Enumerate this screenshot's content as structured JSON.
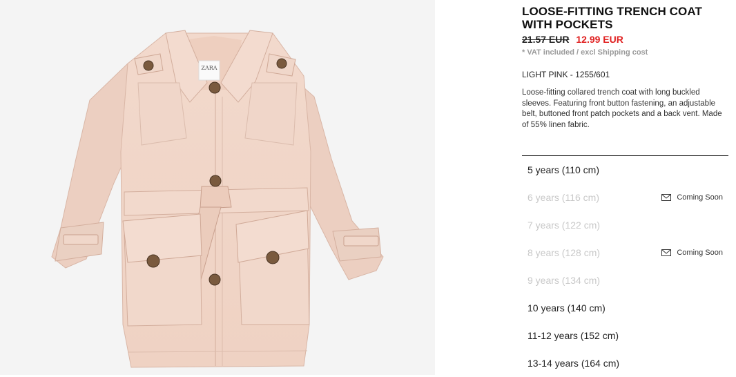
{
  "product": {
    "title": "LOOSE-FITTING TRENCH COAT WITH POCKETS",
    "old_price": "21.57 EUR",
    "new_price": "12.99 EUR",
    "vat_note": "* VAT included / excl Shipping cost",
    "color_ref": "LIGHT PINK - 1255/601",
    "description": "Loose-fitting collared trench coat with long buckled sleeves. Featuring front button fastening, an adjustable belt, buttoned front patch pockets and a back vent. Made of 55% linen fabric.",
    "label_text": "ZARA",
    "sale_color": "#e02020"
  },
  "sizes": [
    {
      "label": "5 years (110 cm)",
      "available": true,
      "note": ""
    },
    {
      "label": "6 years (116 cm)",
      "available": false,
      "note": "Coming Soon"
    },
    {
      "label": "7 years (122 cm)",
      "available": false,
      "note": ""
    },
    {
      "label": "8 years (128 cm)",
      "available": false,
      "note": "Coming Soon"
    },
    {
      "label": "9 years (134 cm)",
      "available": false,
      "note": ""
    },
    {
      "label": "10 years (140 cm)",
      "available": true,
      "note": ""
    },
    {
      "label": "11-12 years (152 cm)",
      "available": true,
      "note": ""
    },
    {
      "label": "13-14 years (164 cm)",
      "available": true,
      "note": ""
    }
  ]
}
